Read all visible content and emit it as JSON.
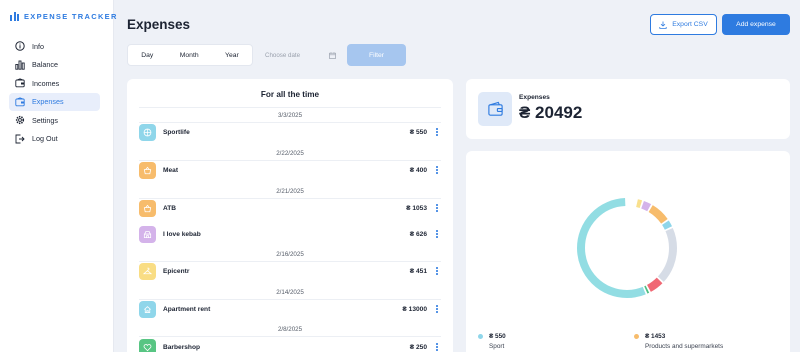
{
  "app": {
    "brand": "EXPENSE TRACKER"
  },
  "sidebar": {
    "items": [
      {
        "label": "Info",
        "icon": "info-icon"
      },
      {
        "label": "Balance",
        "icon": "bar-chart-icon"
      },
      {
        "label": "Incomes",
        "icon": "incomes-icon"
      },
      {
        "label": "Expenses",
        "icon": "wallet-icon",
        "active": true
      },
      {
        "label": "Settings",
        "icon": "gear-icon"
      },
      {
        "label": "Log Out",
        "icon": "logout-icon"
      }
    ]
  },
  "header": {
    "title": "Expenses",
    "export_label": "Export CSV",
    "add_label": "Add expense"
  },
  "filters": {
    "periods": [
      "Day",
      "Month",
      "Year"
    ],
    "date_placeholder": "Choose date",
    "filter_label": "Filter"
  },
  "list": {
    "title": "For all the time",
    "groups": [
      {
        "date": "3/3/2025",
        "items": [
          {
            "name": "Sportlife",
            "amount": "₴ 550",
            "icon": "sport-icon",
            "color": "#8fd6ea"
          }
        ]
      },
      {
        "date": "2/22/2025",
        "items": [
          {
            "name": "Meat",
            "amount": "₴ 400",
            "icon": "basket-icon",
            "color": "#f7bc6c"
          }
        ]
      },
      {
        "date": "2/21/2025",
        "items": [
          {
            "name": "ATB",
            "amount": "₴ 1053",
            "icon": "basket-icon",
            "color": "#f7bc6c"
          },
          {
            "name": "I love kebab",
            "amount": "₴ 626",
            "icon": "restaurant-icon",
            "color": "#d4b3ea"
          }
        ]
      },
      {
        "date": "2/16/2025",
        "items": [
          {
            "name": "Epicentr",
            "amount": "₴ 451",
            "icon": "hanger-icon",
            "color": "#f9dd84"
          }
        ]
      },
      {
        "date": "2/14/2025",
        "items": [
          {
            "name": "Apartment rent",
            "amount": "₴ 13000",
            "icon": "home-icon",
            "color": "#8fd6ea"
          }
        ]
      },
      {
        "date": "2/8/2025",
        "items": [
          {
            "name": "Barbershop",
            "amount": "₴ 250",
            "icon": "heart-icon",
            "color": "#58c583"
          }
        ]
      }
    ]
  },
  "summary": {
    "label": "Expenses",
    "total": "₴ 20492"
  },
  "chart_data": {
    "type": "pie",
    "variant": "donut",
    "colors": {
      "housing": "#92dde3",
      "barbershop": "#4fbf82",
      "red": "#f06874",
      "gray": "#d6dce6",
      "sport": "#8fd6ea",
      "food": "#f7bc6c",
      "restaurant": "#d4b3ea",
      "yellow": "#f9e08d"
    },
    "legend": [
      {
        "value": "₴ 550",
        "label": "Sport",
        "color": "#8fd6ea"
      },
      {
        "value": "₴ 1453",
        "label": "Products and supermarkets",
        "color": "#f7bc6c"
      }
    ]
  }
}
